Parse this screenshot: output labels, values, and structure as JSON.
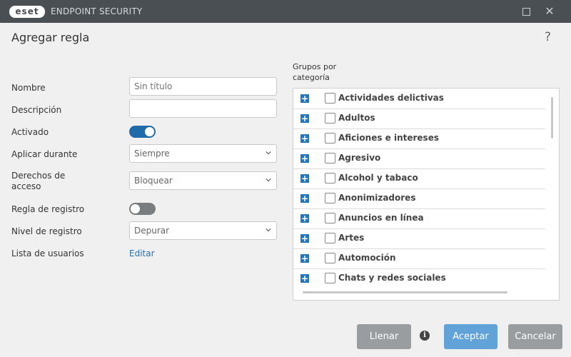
{
  "window": {
    "logo_text": "eset",
    "app_title": "ENDPOINT SECURITY",
    "maximize_icon": "maximize-icon",
    "close_icon": "close-icon"
  },
  "dialog": {
    "title": "Agregar regla",
    "help": "?"
  },
  "form": {
    "name_label": "Nombre",
    "name_placeholder": "Sin título",
    "description_label": "Descripción",
    "description_value": "",
    "enabled_label": "Activado",
    "enabled": true,
    "apply_during_label": "Aplicar durante",
    "apply_during_value": "Siempre",
    "access_rights_label": "Derechos de acceso",
    "access_rights_value": "Bloquear",
    "log_rule_label": "Regla de registro",
    "log_rule": false,
    "log_level_label": "Nivel de registro",
    "log_level_value": "Depurar",
    "user_list_label": "Lista de usuarios",
    "user_list_link": "Editar"
  },
  "groups": {
    "label": "Grupos por categoría",
    "items": [
      {
        "label": "Actividades delictivas",
        "checked": false
      },
      {
        "label": "Adultos",
        "checked": false
      },
      {
        "label": "Aficiones e intereses",
        "checked": false
      },
      {
        "label": "Agresivo",
        "checked": false
      },
      {
        "label": "Alcohol y tabaco",
        "checked": false
      },
      {
        "label": "Anonimizadores",
        "checked": false
      },
      {
        "label": "Anuncios en línea",
        "checked": false
      },
      {
        "label": "Artes",
        "checked": false
      },
      {
        "label": "Automoción",
        "checked": false
      },
      {
        "label": "Chats y redes sociales",
        "checked": false
      }
    ]
  },
  "footer": {
    "fill_button": "Llenar",
    "info_icon": "info-icon",
    "ok_button": "Aceptar",
    "cancel_button": "Cancelar"
  },
  "colors": {
    "titlebar": "#4a4f54",
    "accent": "#2777b8",
    "ok_button": "#61a2d8",
    "neutral_button": "#999da0"
  }
}
